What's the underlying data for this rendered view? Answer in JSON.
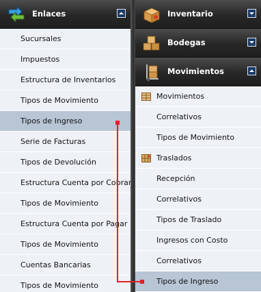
{
  "left": {
    "header": {
      "title": "Enlaces",
      "icon": "arrows-icon"
    },
    "items": [
      "Sucursales",
      "Impuestos",
      "Estructura de Inventarios",
      "Tipos de Movimiento",
      "Tipos de Ingreso",
      "Serie de Facturas",
      "Tipos de Devolución",
      "Estructura Cuenta por Cobrar",
      "Tipos de Movimiento",
      "Estructura Cuenta por Pagar",
      "Tipos de Movimiento",
      "Cuentas Bancarias",
      "Tipos de Movimiento"
    ],
    "highlighted_index": 4
  },
  "right": {
    "sections": [
      {
        "title": "Inventario",
        "icon": "box-icon"
      },
      {
        "title": "Bodegas",
        "icon": "boxes-icon"
      },
      {
        "title": "Movimientos",
        "icon": "hand-truck-icon"
      }
    ],
    "groups": [
      {
        "label": "Movimientos",
        "children": [
          "Correlativos",
          "Tipos de Movimiento"
        ]
      },
      {
        "label": "Traslados",
        "children": [
          "Recepción",
          "Correlativos",
          "Tipos de Traslado",
          "Ingresos con Costo",
          "Correlativos",
          "Tipos de Ingreso"
        ]
      }
    ]
  },
  "colors": {
    "connector": "#e0202a",
    "highlight": "#b7c5d4",
    "header_dark": "#272727",
    "toggle": "#1b3a67"
  }
}
